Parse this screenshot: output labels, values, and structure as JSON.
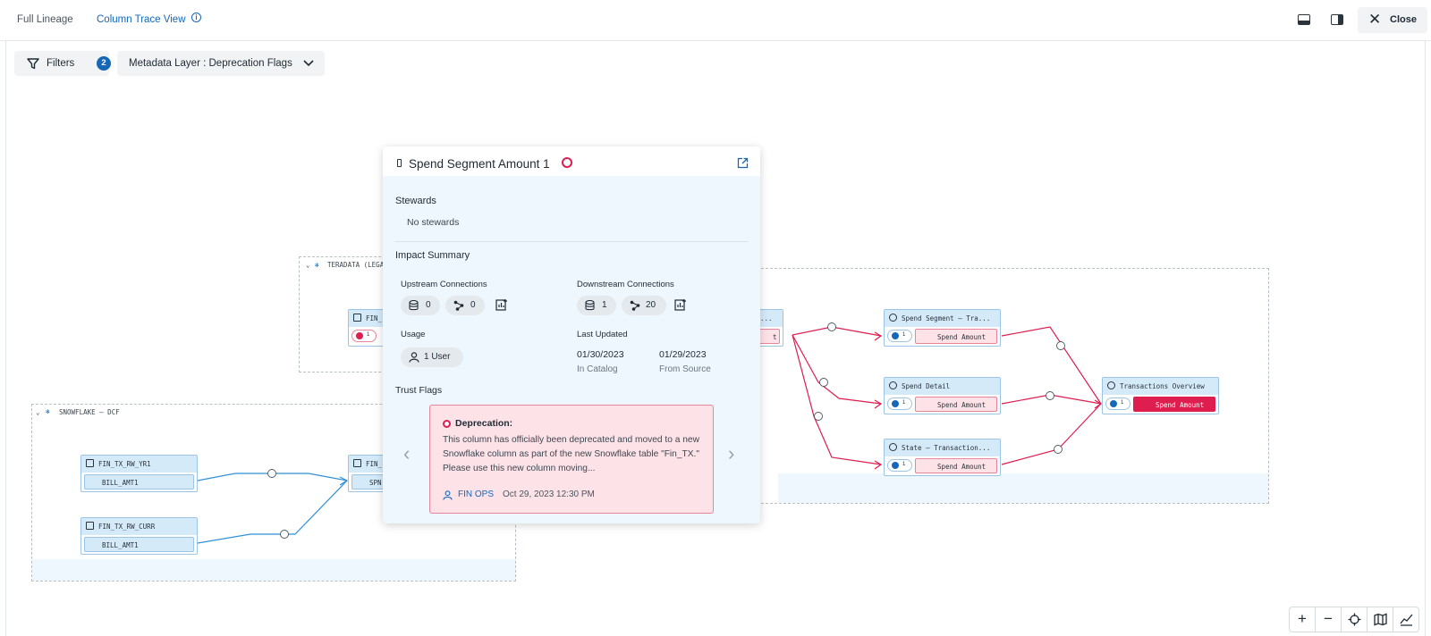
{
  "header": {
    "tab_full": "Full Lineage",
    "tab_trace": "Column Trace View",
    "info": "i",
    "close_label": "Close"
  },
  "toolbar": {
    "filters_label": "Filters",
    "filters_count": "2",
    "layer_label": "Metadata Layer : Deprecation Flags"
  },
  "groups": {
    "teradata": "TERADATA (LEGA",
    "snowflake": "SNOWFLAKE – DCF"
  },
  "nodes": {
    "fin_partial": "FIN_",
    "fin_partial_badge": "1",
    "fin_partial_2": "FIN_",
    "fin_partial_2_col": "SPN",
    "fin_tx_rw_yr1": "FIN_TX_RW_YR1",
    "fin_tx_rw_yr1_col": "BILL_AMT1",
    "fin_tx_rw_curr": "FIN_TX_RW_CURR",
    "fin_tx_rw_curr_col": "BILL_AMT1",
    "center_partial_head": "...",
    "center_partial_col": "t",
    "spend_segment_tra": "Spend Segment – Tra...",
    "spend_detail": "Spend Detail",
    "state_transaction": "State – Transaction...",
    "spend_amount": "Spend Amount",
    "transactions_overview": "Transactions Overview",
    "flag_count": "1"
  },
  "popup": {
    "title": "Spend Segment Amount 1",
    "stewards_title": "Stewards",
    "stewards_value": "No stewards",
    "impact_title": "Impact Summary",
    "upstream_label": "Upstream Connections",
    "upstream_tables": "0",
    "upstream_lineage": "0",
    "downstream_label": "Downstream Connections",
    "downstream_tables": "1",
    "downstream_lineage": "20",
    "usage_label": "Usage",
    "usage_value": "1 User",
    "last_updated_label": "Last Updated",
    "catalog_date": "01/30/2023",
    "catalog_label": "In Catalog",
    "source_date": "01/29/2023",
    "source_label": "From Source",
    "trust_flags_title": "Trust Flags",
    "trust_type": "Deprecation:",
    "trust_text": "This column has officially been deprecated and moved to a new Snowflake column as part of the new Snowflake table \"Fin_TX.\" Please use this new column moving...",
    "trust_author": "FIN OPS",
    "trust_date": "Oct 29, 2023 12:30 PM",
    "prev_arrow": "‹",
    "next_arrow": "›"
  },
  "zoom": {
    "zoom_in": "+",
    "zoom_out": "−"
  },
  "colors": {
    "accent": "#1767b8",
    "deprecation": "#dd1e4f",
    "node_blue": "#d4eaf9",
    "node_pink": "#fde2e7"
  }
}
